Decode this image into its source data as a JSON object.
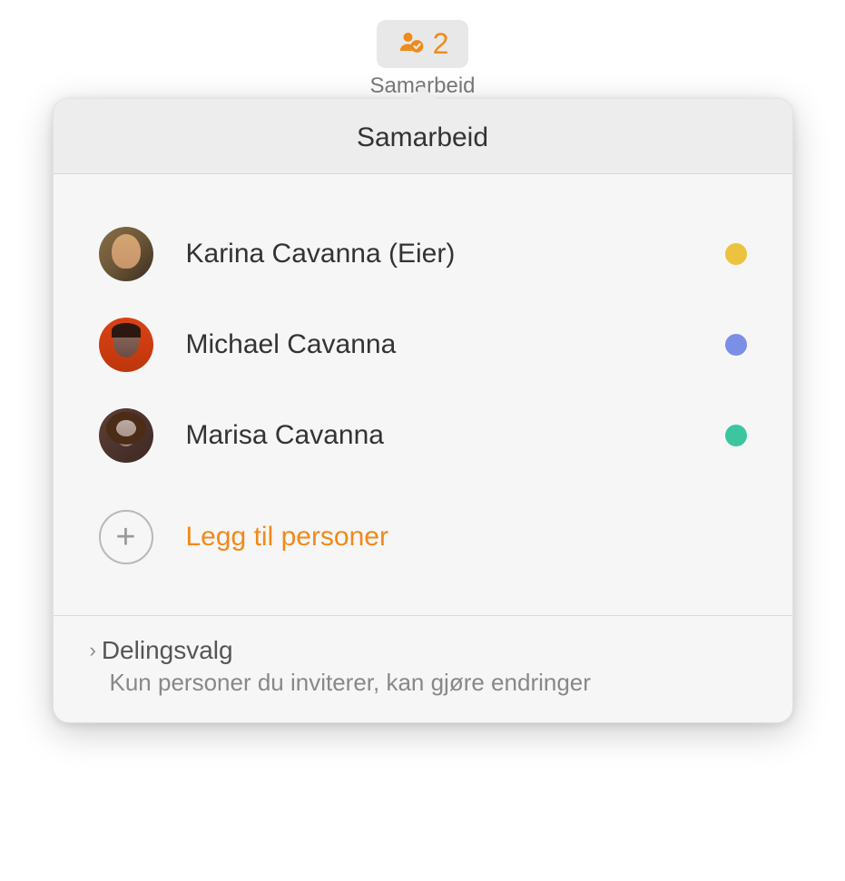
{
  "toolbar": {
    "count": "2",
    "label": "Samarbeid"
  },
  "popover": {
    "title": "Samarbeid",
    "participants": [
      {
        "name": "Karina Cavanna (Eier)",
        "status_color": "yellow"
      },
      {
        "name": "Michael Cavanna",
        "status_color": "blue"
      },
      {
        "name": "Marisa Cavanna",
        "status_color": "green"
      }
    ],
    "add_people_label": "Legg til personer",
    "sharing_options": {
      "title": "Delingsvalg",
      "description": "Kun personer du inviterer, kan gjøre endringer"
    }
  }
}
